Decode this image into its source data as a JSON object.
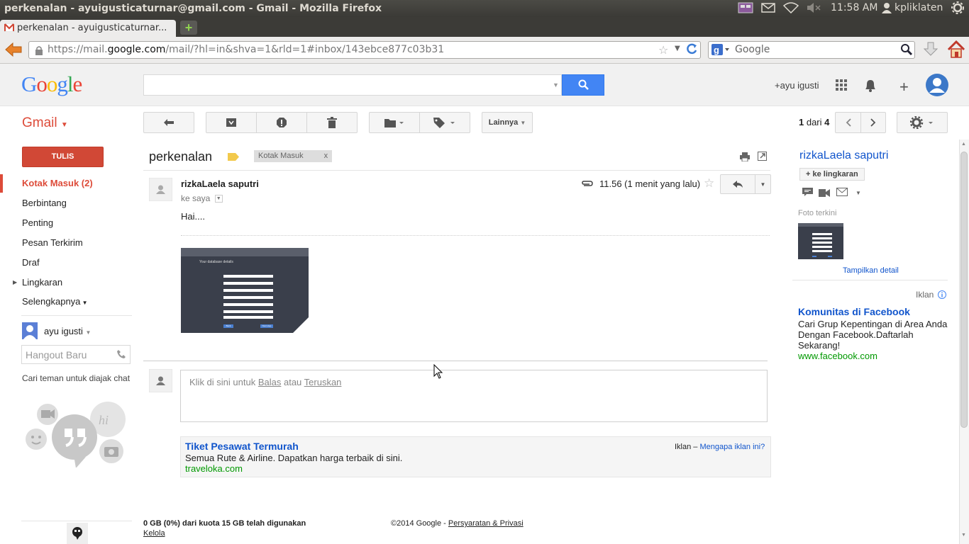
{
  "os": {
    "window_title": "perkenalan - ayuigusticaturnar@gmail.com - Gmail - Mozilla Firefox",
    "clock": "11:58 AM",
    "user": "kpliklaten"
  },
  "browser": {
    "tab_title": "perkenalan - ayuigusticaturnar...",
    "url_prefix": "https://mail.",
    "url_domain": "google.com",
    "url_rest": "/mail/?hl=in&shva=1&rld=1#inbox/143ebce877c03b31",
    "search_placeholder": "Google"
  },
  "google": {
    "logo": "Google",
    "user_label": "+ayu igusti"
  },
  "gmail": {
    "brand": "Gmail",
    "more_label": "Lainnya",
    "pager_current": "1",
    "pager_mid": " dari ",
    "pager_total": "4",
    "compose": "TULIS",
    "nav": [
      "Kotak Masuk (2)",
      "Berbintang",
      "Penting",
      "Pesan Terkirim",
      "Draf",
      "Lingkaran",
      "Selengkapnya"
    ],
    "hangout_user": "ayu igusti",
    "hangout_placeholder": "Hangout Baru",
    "hangout_hint": "Cari teman untuk diajak chat"
  },
  "message": {
    "subject": "perkenalan",
    "label": "Kotak Masuk",
    "label_close": "x",
    "sender": "rizkaLaela saputri",
    "to": "ke saya",
    "time": "11.56 (1 menit yang lalu)",
    "body": "Hai....",
    "reply_prefix": "Klik di sini untuk ",
    "reply_link": "Balas",
    "reply_mid": " atau ",
    "forward_link": "Teruskan"
  },
  "attachment_preview": {
    "heading": "Your database details",
    "buttons": [
      "Back",
      "Next step"
    ]
  },
  "ad_bottom": {
    "title": "Tiket Pesawat Termurah",
    "text": "Semua Rute & Airline. Dapatkan harga terbaik di sini.",
    "url": "traveloka.com",
    "iklan": "Iklan – ",
    "why": "Mengapa iklan ini?"
  },
  "footer": {
    "quota": "0 GB (0%) dari kuota 15 GB telah digunakan",
    "manage": "Kelola",
    "copyright": "©2014 Google - ",
    "terms": "Persyaratan & Privasi"
  },
  "contact": {
    "name": "rizkaLaela saputri",
    "add_circle": "+ ke lingkaran",
    "recent_photos": "Foto terkini",
    "show_details": "Tampilkan detail"
  },
  "ad_right": {
    "label": "Iklan",
    "title": "Komunitas di Facebook",
    "text": "Cari Grup Kepentingan di Area Anda Dengan Facebook.Daftarlah Sekarang!",
    "url": "www.facebook.com"
  },
  "colors": {
    "gmail_red": "#dd4b39",
    "compose_red": "#d14836",
    "link_blue": "#15c",
    "search_blue": "#4285f4",
    "ad_green": "#090"
  }
}
